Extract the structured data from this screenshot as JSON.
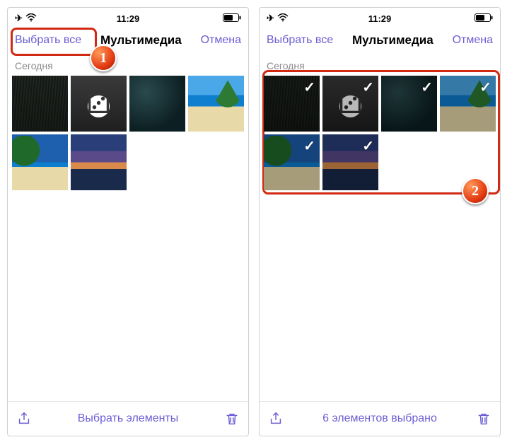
{
  "status": {
    "time": "11:29"
  },
  "nav": {
    "select_all": "Выбрать все",
    "title": "Мультимедиа",
    "cancel": "Отмена"
  },
  "section": "Сегодня",
  "toolbar": {
    "left_hint": "Выбрать элементы",
    "right_hint": "6 элементов выбрано"
  },
  "badges": {
    "one": "1",
    "two": "2"
  },
  "thumbs": [
    {
      "name": "grass"
    },
    {
      "name": "dice"
    },
    {
      "name": "rock"
    },
    {
      "name": "beach-palm-right"
    },
    {
      "name": "beach-palm-left"
    },
    {
      "name": "sunset"
    }
  ]
}
